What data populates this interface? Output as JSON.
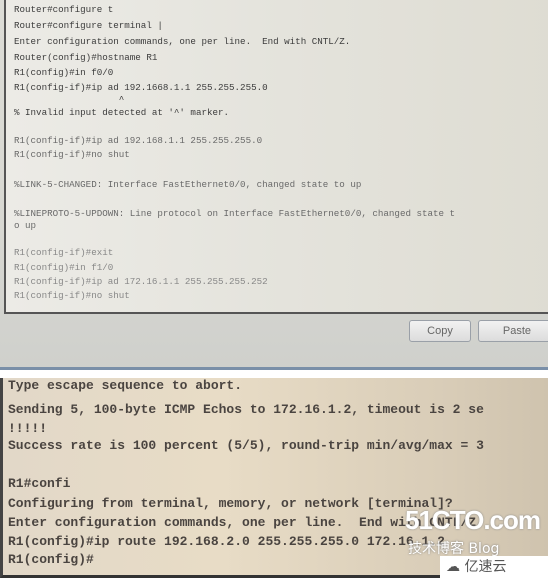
{
  "top_terminal": {
    "lines": [
      "Router#configure t",
      "Router#configure terminal |",
      "Enter configuration commands, one per line.  End with CNTL/Z.",
      "Router(config)#hostname R1",
      "R1(config)#in f0/0",
      "R1(config-if)#ip ad 192.1668.1.1 255.255.255.0",
      "                   ^",
      "% Invalid input detected at '^' marker.",
      "R1(config-if)#ip ad 192.168.1.1 255.255.255.0",
      "R1(config-if)#no shut",
      "%LINK-5-CHANGED: Interface FastEthernet0/0, changed state to up",
      "%LINEPROTO-5-UPDOWN: Line protocol on Interface FastEthernet0/0, changed state t",
      "o up",
      "R1(config-if)#exit",
      "R1(config)#in f1/0",
      "R1(config-if)#ip ad 172.16.1.1 255.255.255.252",
      "R1(config-if)#no shut"
    ],
    "copy_label": "Copy",
    "paste_label": "Paste"
  },
  "bottom_terminal": {
    "lines": [
      "Type escape sequence to abort.",
      "Sending 5, 100-byte ICMP Echos to 172.16.1.2, timeout is 2 se",
      "!!!!!",
      "Success rate is 100 percent (5/5), round-trip min/avg/max = 3",
      "R1#confi",
      "Configuring from terminal, memory, or network [terminal]?",
      "Enter configuration commands, one per line.  End with CNTL/Z.",
      "R1(config)#ip route 192.168.2.0 255.255.255.0 172.16.1.2",
      "R1(config)#"
    ]
  },
  "watermark": {
    "site": "51CTO.com",
    "tagline": "技术博客 Blog",
    "logo": "亿速云"
  }
}
